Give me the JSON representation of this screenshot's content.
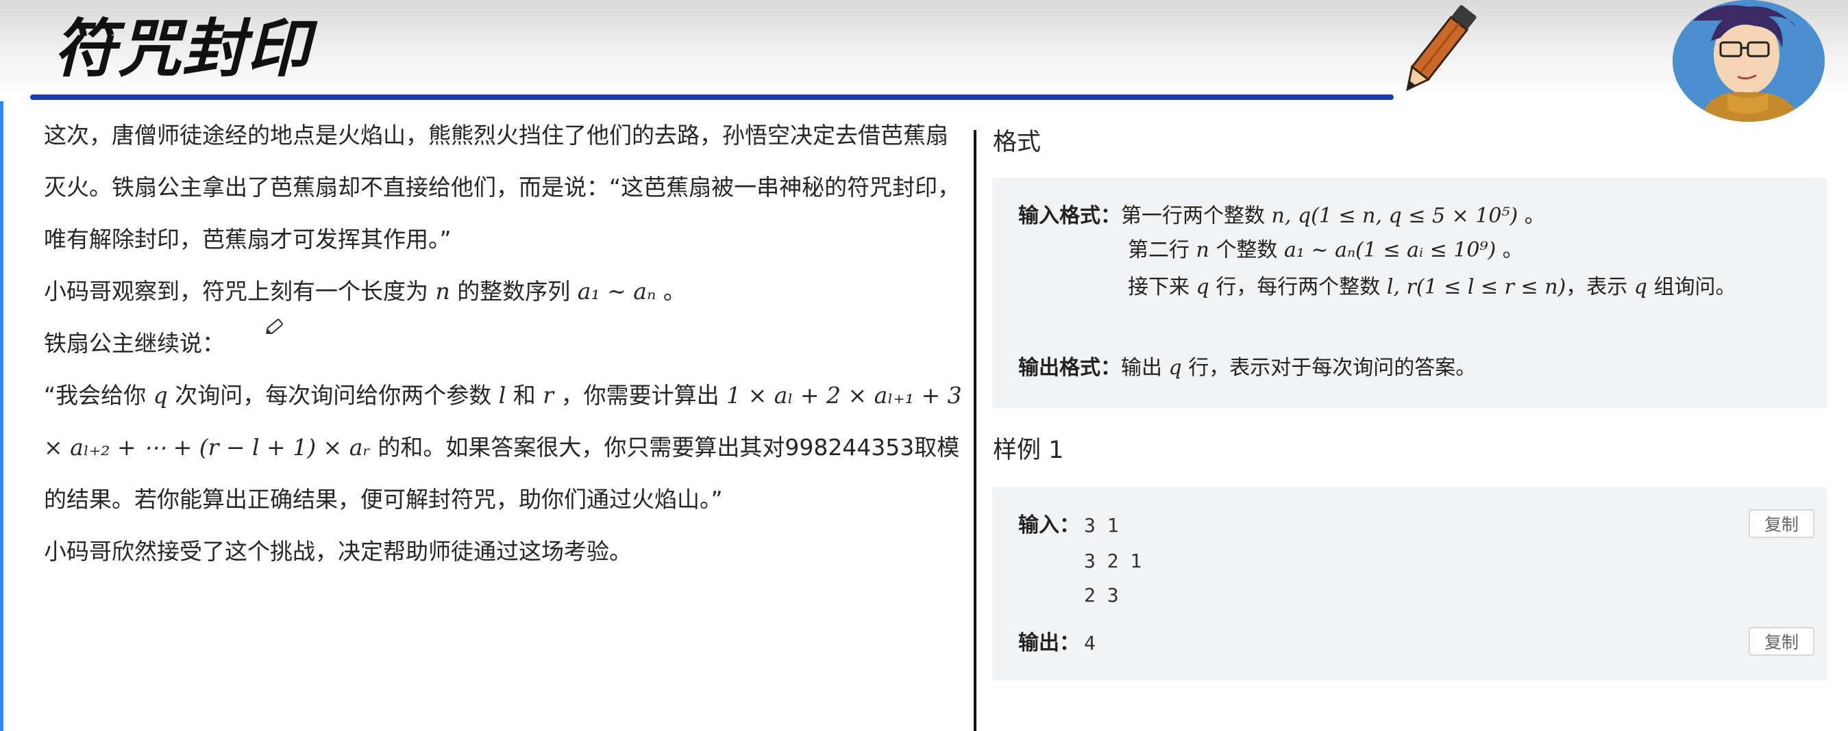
{
  "header": {
    "title": "符咒封印",
    "icons": [
      "pencil-icon",
      "avatar"
    ]
  },
  "story": {
    "paragraph1": "这次，唐僧师徒途经的地点是火焰山，熊熊烈火挡住了他们的去路，孙悟空决定去借芭蕉扇灭火。铁扇公主拿出了芭蕉扇却不直接给他们，而是说：“这芭蕉扇被一串神秘的符咒封印，唯有解除封印，芭蕉扇才可发挥其作用。”",
    "paragraph2_a": "小码哥观察到，符咒上刻有一个长度为",
    "paragraph2_var": "n",
    "paragraph2_b": "的整数序列",
    "paragraph2_seq": "a₁ ~ aₙ",
    "paragraph2_end": "。",
    "paragraph3": "铁扇公主继续说：",
    "paragraph4_a": "“我会给你",
    "paragraph4_q": "q",
    "paragraph4_b": "次询问，每次询问给你两个参数",
    "paragraph4_l": "l",
    "paragraph4_and": "和",
    "paragraph4_r": "r",
    "paragraph4_c": "，你需要计算出",
    "paragraph4_formula1": "1 × aₗ + 2 ×",
    "paragraph4_formula2": "aₗ₊₁ + 3 × aₗ₊₂ + ⋯ + (r − l + 1) × aᵣ",
    "paragraph4_d": "的和。如果答案很大，你只需要算出其对998244353取模的结果。若你能算出正确结果，便可解封符咒，助你们通过火焰山。”",
    "paragraph5": "小码哥欣然接受了这个挑战，决定帮助师徒通过这场考验。"
  },
  "format": {
    "heading": "格式",
    "input_label": "输入格式：",
    "input_line1_a": "第一行两个整数",
    "input_line1_math": "n, q(1 ≤ n, q ≤ 5 × 10⁵)",
    "input_line1_end": "。",
    "input_line2_a": "第二行",
    "input_line2_n": "n",
    "input_line2_b": "个整数",
    "input_line2_math": "a₁ ∼ aₙ(1 ≤ aᵢ ≤ 10⁹)",
    "input_line2_end": "。",
    "input_line3_a": "接下来",
    "input_line3_q": "q",
    "input_line3_b": "行，每行两个整数",
    "input_line3_math": "l, r(1 ≤ l ≤ r ≤ n)",
    "input_line3_c": "，表示",
    "input_line3_q2": "q",
    "input_line3_d": "组询问。",
    "output_label": "输出格式：",
    "output_a": "输出",
    "output_q": "q",
    "output_b": "行，表示对于每次询问的答案。"
  },
  "sample": {
    "heading": "样例 1",
    "input_label": "输入：",
    "input_lines": [
      "3 1",
      "3 2 1",
      "2 3"
    ],
    "output_label": "输出：",
    "output_value": "4",
    "copy_label": "复制"
  },
  "colors": {
    "underline": "#1f3ab5",
    "panel_bg": "#f2f3f5",
    "left_edge": "#2a8cff"
  }
}
